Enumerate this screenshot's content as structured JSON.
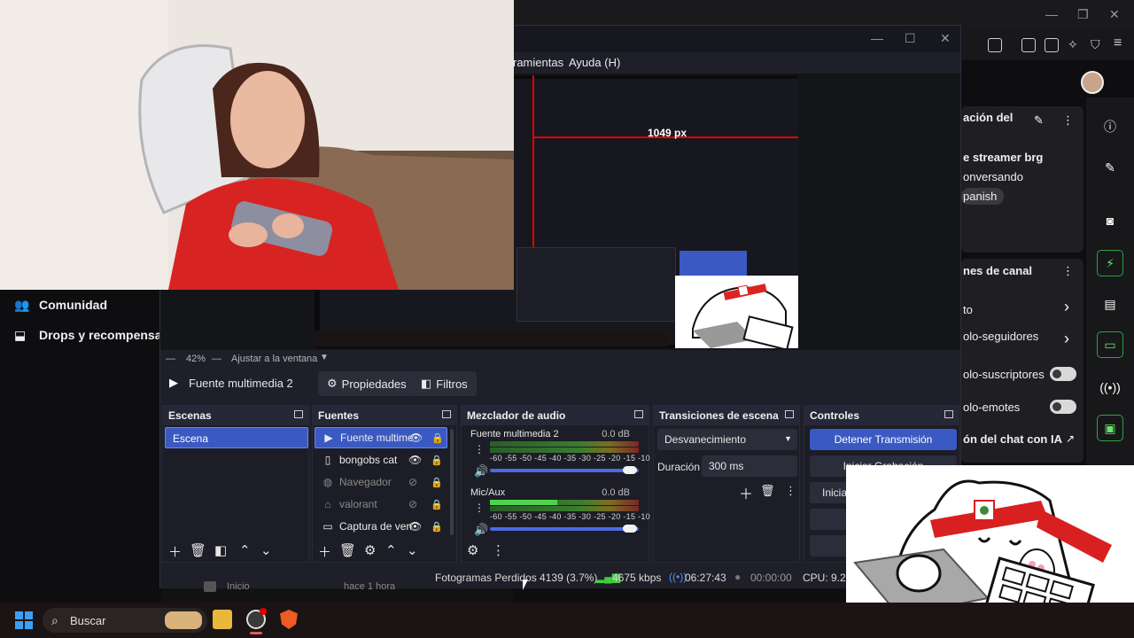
{
  "browser": {
    "window_controls": [
      "—",
      "❐",
      "✕"
    ],
    "stream_info_partial_title": "ación del",
    "stream_tag_line1": "e streamer brg",
    "stream_tag_line2": "onversando",
    "stream_tag_chip": "panish",
    "channel_section_partial": "nes de canal",
    "row_to": "to",
    "row_seguidores": "olo-seguidores",
    "row_suscriptores": "olo-suscriptores",
    "row_emotes": "olo-emotes",
    "row_chat_ia": "ón del chat con IA"
  },
  "twitch_sidebar": {
    "items": [
      {
        "label": "Comunidad",
        "icon": "community-icon"
      },
      {
        "label": "Drops y recompensas",
        "icon": "drops-icon"
      }
    ]
  },
  "obs": {
    "window_controls": [
      "—",
      "☐",
      "✕"
    ],
    "menu": {
      "herramientas_partial": "ramientas",
      "ayuda": "Ayuda (H)"
    },
    "preview_overlay_label": "1049 px",
    "zoom_label": "42%",
    "fit_label": "Ajustar a la ventana",
    "selected_source_label": "Fuente multimedia 2",
    "properties_label": "Propiedades",
    "filters_label": "Filtros",
    "docks": {
      "scenes": {
        "title": "Escenas",
        "items": [
          "Escena"
        ]
      },
      "sources": {
        "title": "Fuentes",
        "items": [
          {
            "name": "Fuente multime",
            "icon": "play-icon",
            "visible": true
          },
          {
            "name": "bongobs cat",
            "icon": "file-icon",
            "visible": true
          },
          {
            "name": "Navegador",
            "icon": "globe-icon",
            "visible": false
          },
          {
            "name": "valorant",
            "icon": "gamepad-icon",
            "visible": false
          },
          {
            "name": "Captura de vent",
            "icon": "window-icon",
            "visible": true
          }
        ]
      },
      "mixer": {
        "title": "Mezclador de audio",
        "channels": [
          {
            "name": "Fuente multimedia 2",
            "db": "0.0 dB",
            "level": 0.0,
            "volume": 1.0
          },
          {
            "name": "Mic/Aux",
            "db": "0.0 dB",
            "level": 0.45,
            "volume": 1.0
          }
        ],
        "scale": "-60 -55 -50 -45 -40 -35 -30 -25 -20 -15 -10  -5   0"
      },
      "transitions": {
        "title": "Transiciones de escena",
        "transition": "Desvanecimiento",
        "duration_label": "Duración",
        "duration_value": "300 ms"
      },
      "controls": {
        "title": "Controles",
        "stop_stream": "Detener Transmisión",
        "start_record": "Iniciar Grabación",
        "partial_button": "Inicia"
      }
    },
    "status": {
      "dropped_frames": "Fotogramas Perdidos 4139 (3.7%)",
      "bitrate": "4675 kbps",
      "stream_time": "06:27:43",
      "record_time": "00:00:00",
      "cpu": "CPU: 9.2%"
    },
    "behind_text": {
      "inicio": "Inicio",
      "hace": "hace 1 hora"
    }
  },
  "taskbar": {
    "search_placeholder": "Buscar",
    "apps": [
      "file-explorer-icon",
      "obs-icon",
      "brave-icon"
    ]
  },
  "colors": {
    "accent": "#3b59c2",
    "obs_bg": "#1e1f29",
    "twitch_bg": "#0e0e10",
    "meter_green": "#4fd34f",
    "live_red": "#e00000"
  }
}
